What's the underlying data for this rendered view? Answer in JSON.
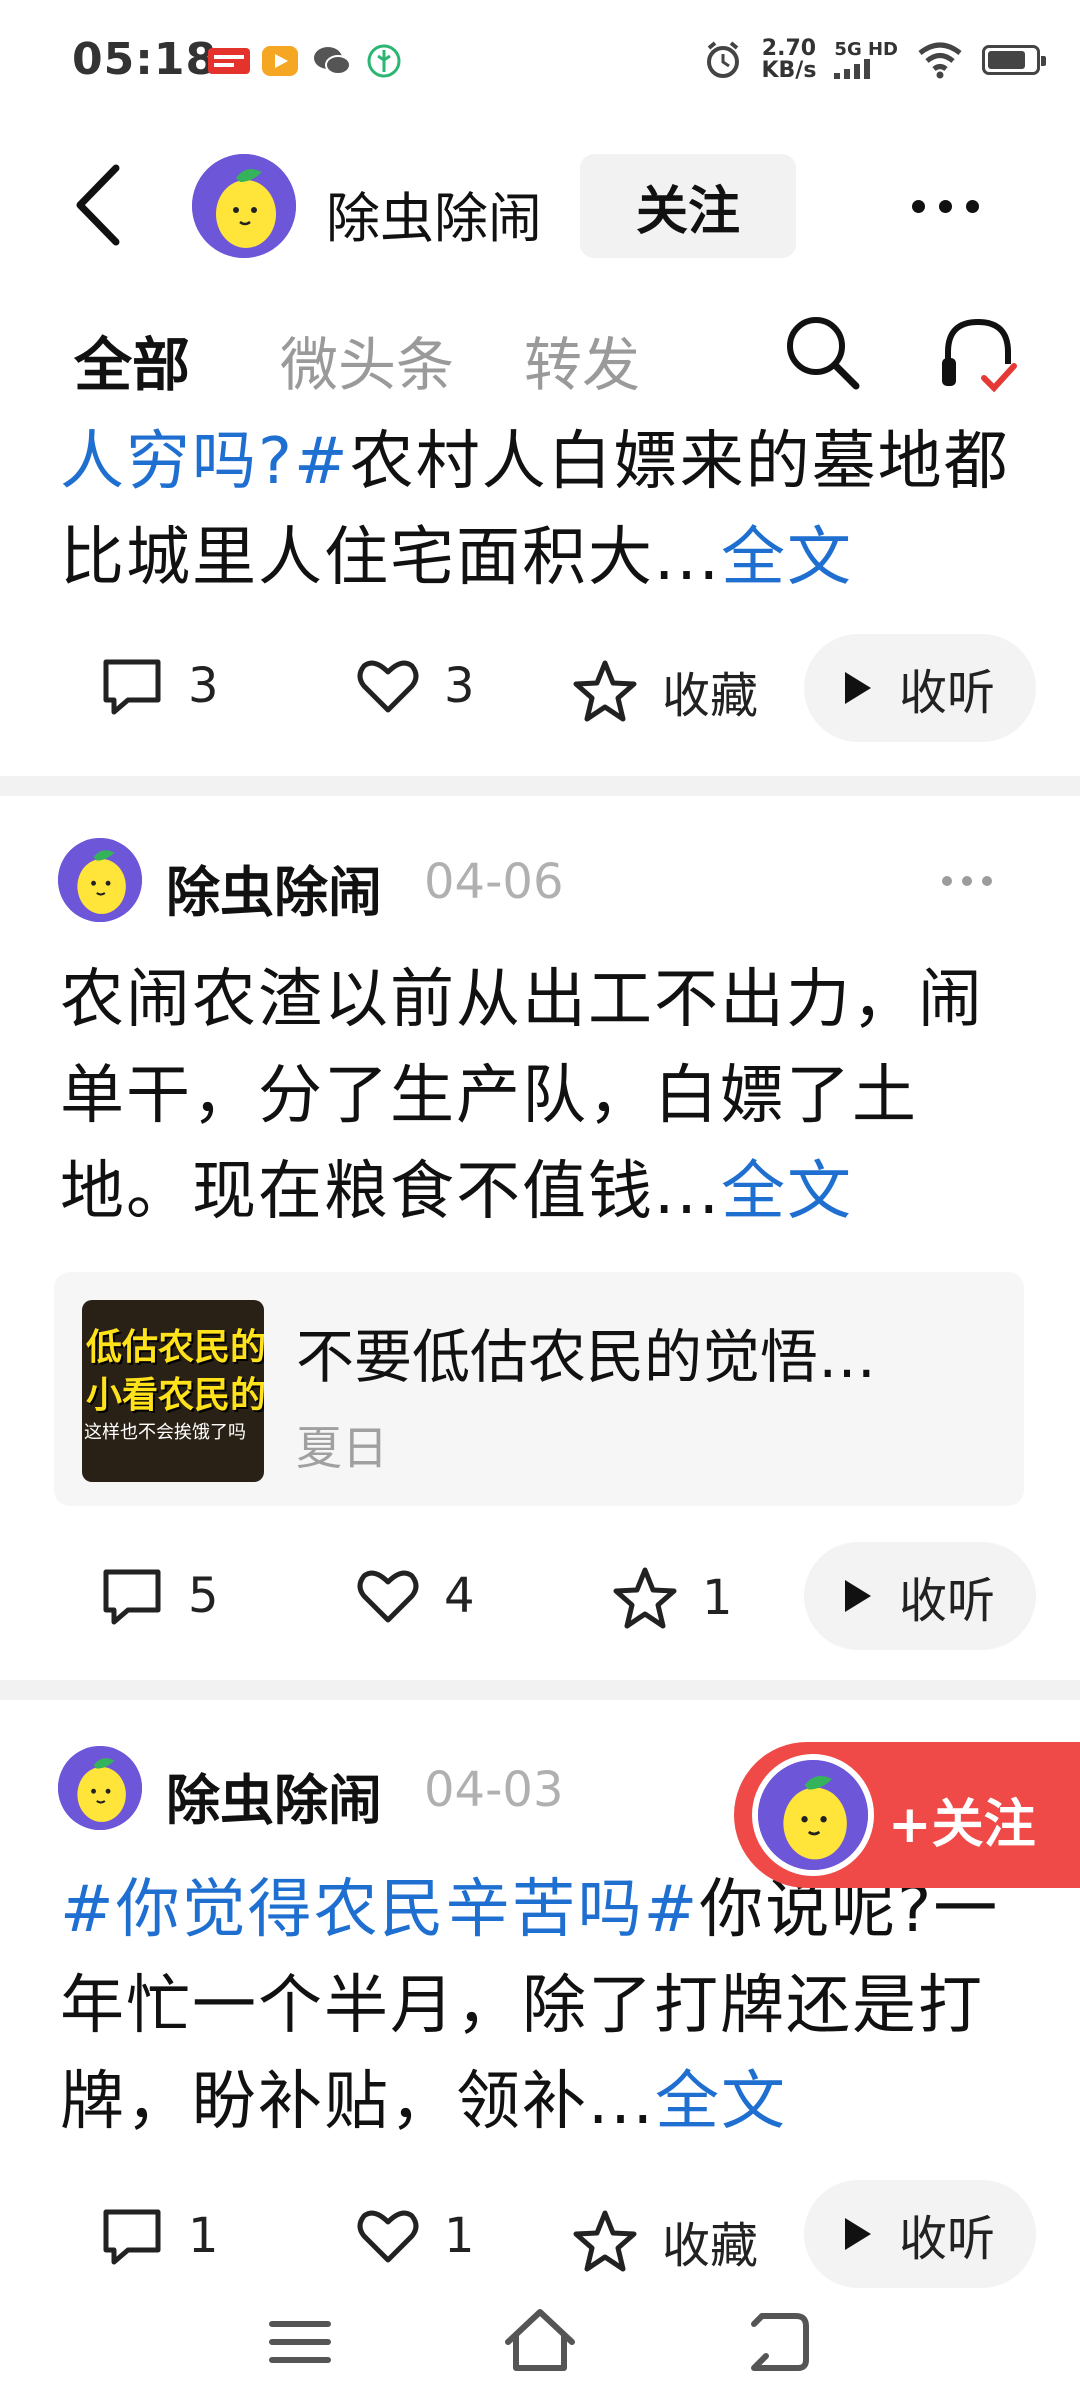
{
  "status_bar": {
    "time": "05:18",
    "net_speed_value": "2.70",
    "net_speed_unit": "KB/s",
    "network": "5G HD",
    "battery_level": 0.8,
    "app_icons": [
      "toutiao-icon",
      "video-app-icon",
      "wechat-icon",
      "leaf-app-icon"
    ]
  },
  "header": {
    "name": "除虫除闹",
    "follow_label": "关注"
  },
  "tabs": [
    {
      "label": "全部",
      "active": true
    },
    {
      "label": "微头条",
      "active": false
    },
    {
      "label": "转发",
      "active": false
    }
  ],
  "posts": [
    {
      "text_hashtag": "人穷吗?#",
      "text_body": "农村人白嫖来的墓地都比城里人住宅面积大...",
      "full_label": "全文",
      "comments": "3",
      "likes": "3",
      "favorite": "收藏",
      "listen": "收听"
    },
    {
      "author": "除虫除闹",
      "date": "04-06",
      "text_body": "农闹农渣以前从出工不出力，闹单干，分了生产队，白嫖了土地。现在粮食不值钱...",
      "full_label": "全文",
      "card": {
        "title": "不要低估农民的觉悟…",
        "author": "夏日",
        "thumb_line1": "低估农民的觉",
        "thumb_line2": "小看农民的格",
        "thumb_line3": "这样也不会挨饿了吗"
      },
      "comments": "5",
      "likes": "4",
      "favorites": "1",
      "listen": "收听"
    },
    {
      "author": "除虫除闹",
      "date": "04-03",
      "text_hashtag": "#你觉得农民辛苦吗#",
      "text_body": "你说呢?一年忙一个半月，除了打牌还是打牌，盼补贴，领补...",
      "full_label": "全文",
      "comments": "1",
      "likes": "1",
      "favorite": "收藏",
      "listen": "收听"
    }
  ],
  "floating_follow": {
    "label": "+关注"
  },
  "colors": {
    "link_blue": "#1f6fd1",
    "follow_red": "#f04a48",
    "avatar_purple": "#6d57d8"
  }
}
